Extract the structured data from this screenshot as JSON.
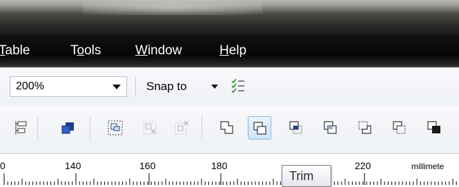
{
  "menubar": {
    "items": [
      {
        "label": "Table",
        "underline": "T"
      },
      {
        "label": "Tools",
        "underline": "o"
      },
      {
        "label": "Window",
        "underline": "W"
      },
      {
        "label": "Help",
        "underline": "H"
      }
    ]
  },
  "toolbar": {
    "zoom_value": "200%",
    "snap_label": "Snap to",
    "buttons": [
      {
        "name": "align-distribute-icon"
      },
      {
        "name": "arrange-order-icon"
      },
      {
        "name": "group-objects-icon"
      },
      {
        "name": "ungroup-objects-icon"
      },
      {
        "name": "ungroup-all-icon"
      },
      {
        "name": "weld-icon"
      },
      {
        "name": "trim-icon"
      },
      {
        "name": "intersect-icon"
      },
      {
        "name": "simplify-icon"
      },
      {
        "name": "front-minus-back-icon"
      },
      {
        "name": "back-minus-front-icon"
      },
      {
        "name": "create-boundary-icon"
      }
    ],
    "active_button": "trim-icon"
  },
  "ruler": {
    "labels": [
      "0",
      "140",
      "160",
      "180",
      "220"
    ],
    "unit": "millimete"
  },
  "tooltip": {
    "text": "Trim"
  },
  "colors": {
    "menubar_bg": "#050505",
    "toolbar_bg": "#eef1f5",
    "active_button_border": "#8eb4de",
    "icon_dark": "#1f3f8f"
  }
}
